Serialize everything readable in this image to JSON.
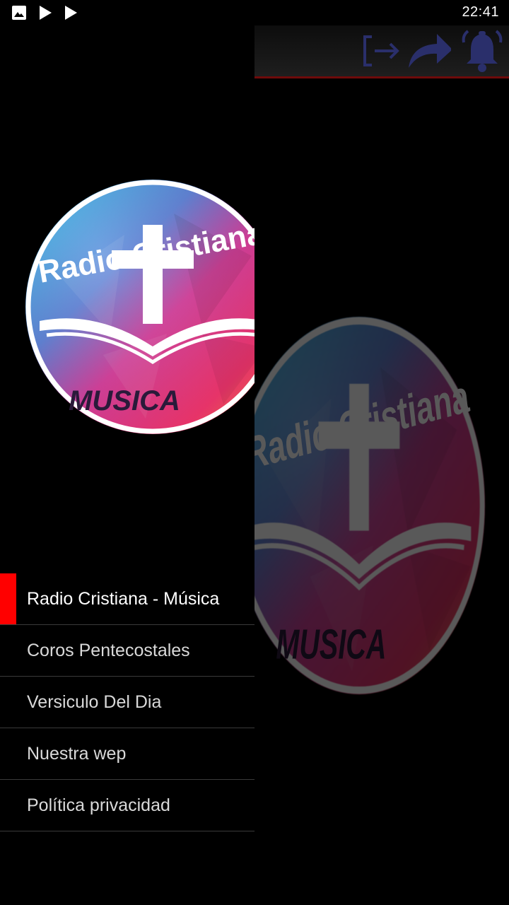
{
  "status_bar": {
    "time": "22:41",
    "icons": [
      "image-icon",
      "play-icon",
      "play-icon"
    ]
  },
  "toolbar": {
    "actions": [
      "exit-icon",
      "share-icon",
      "notification-bell-icon"
    ],
    "accent_color": "#2a2f6b",
    "divider_color": "#6e0a0a"
  },
  "logo": {
    "title": "Radio Cristiana",
    "subtitle": "MUSICA"
  },
  "menu": {
    "active_indicator_color": "#ff0000",
    "items": [
      {
        "label": "Radio Cristiana - Música",
        "active": true
      },
      {
        "label": "Coros Pentecostales",
        "active": false
      },
      {
        "label": "Versiculo Del Dia",
        "active": false
      },
      {
        "label": "Nuestra wep",
        "active": false
      },
      {
        "label": "Política privacidad",
        "active": false
      }
    ]
  }
}
